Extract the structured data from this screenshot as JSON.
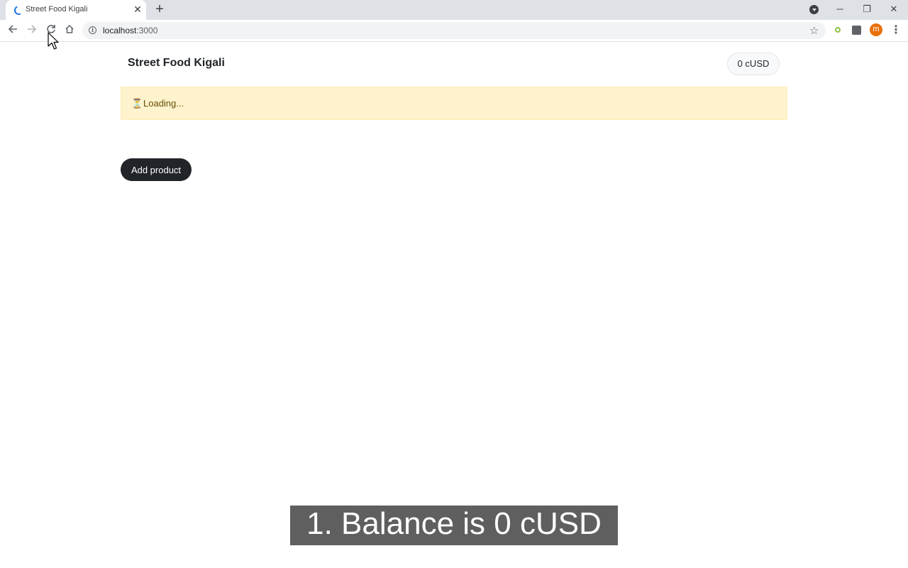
{
  "browser": {
    "tab": {
      "title": "Street Food Kigali",
      "close_icon": "✕"
    },
    "new_tab_icon": "+",
    "address": {
      "host": "localhost",
      "port": ":3000"
    },
    "window_controls": {
      "minimize": "─",
      "restore": "❐",
      "close": "✕"
    },
    "profile_initial": "m",
    "icons": [
      "back-icon",
      "forward-icon",
      "reload-icon",
      "home-icon",
      "info-icon",
      "star-icon",
      "extension-icon",
      "puzzle-icon",
      "menu-icon"
    ]
  },
  "app": {
    "title": "Street Food Kigali",
    "balance": "0 cUSD",
    "alert": {
      "icon": "⏳",
      "text": "Loading..."
    },
    "add_product_label": "Add product"
  },
  "caption": {
    "text": "1. Balance is 0 cUSD"
  },
  "colors": {
    "alert_bg": "#fff3cd",
    "button_dark": "#212529",
    "caption_bg": "#5f5f5f",
    "avatar": "#e8710a"
  }
}
